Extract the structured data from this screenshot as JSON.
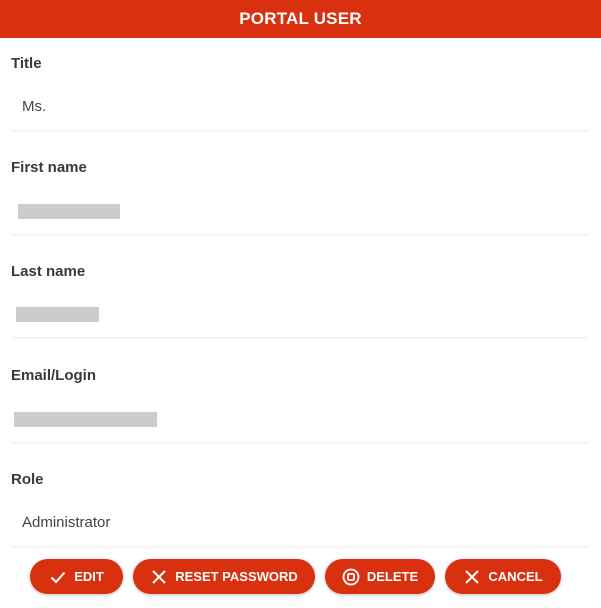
{
  "header": {
    "title": "PORTAL USER"
  },
  "fields": [
    {
      "label": "Title",
      "value": "Ms."
    },
    {
      "label": "First name",
      "value": ""
    },
    {
      "label": "Last name",
      "value": ""
    },
    {
      "label": "Email/Login",
      "value": ""
    },
    {
      "label": "Role",
      "value": "Administrator"
    }
  ],
  "actions": {
    "edit_label": "EDIT",
    "reset_label": "RESET PASSWORD",
    "delete_label": "DELETE",
    "cancel_label": "CANCEL"
  },
  "icons": {
    "edit": "check-icon",
    "reset": "close-icon",
    "delete": "stop-circle-icon",
    "cancel": "close-icon"
  },
  "colors": {
    "accent": "#d9310f",
    "redacted": "#cccccc"
  }
}
